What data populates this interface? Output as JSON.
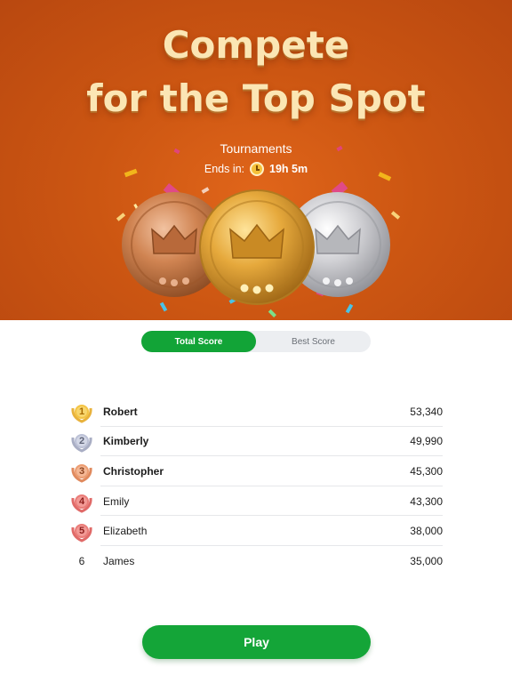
{
  "header": {
    "headline_line1": "Compete",
    "headline_line2": "for the Top Spot",
    "section_label": "Tournaments",
    "ends_label": "Ends in:",
    "ends_time": "19h 5m",
    "clock_icon": "clock-icon"
  },
  "medals": [
    {
      "name": "bronze-medal",
      "color": "#c97a4a"
    },
    {
      "name": "gold-medal",
      "color": "#e3a43a"
    },
    {
      "name": "silver-medal",
      "color": "#c6c6c8"
    }
  ],
  "tabs": [
    {
      "label": "Total Score",
      "active": true
    },
    {
      "label": "Best Score",
      "active": false
    }
  ],
  "leaderboard": [
    {
      "rank": "1",
      "name": "Robert",
      "score": "53,340",
      "badge": "gold",
      "bold": true
    },
    {
      "rank": "2",
      "name": "Kimberly",
      "score": "49,990",
      "badge": "silver",
      "bold": true
    },
    {
      "rank": "3",
      "name": "Christopher",
      "score": "45,300",
      "badge": "bronze",
      "bold": true
    },
    {
      "rank": "4",
      "name": "Emily",
      "score": "43,300",
      "badge": "red",
      "bold": false
    },
    {
      "rank": "5",
      "name": "Elizabeth",
      "score": "38,000",
      "badge": "red",
      "bold": false
    },
    {
      "rank": "6",
      "name": "James",
      "score": "35,000",
      "badge": "none",
      "bold": false
    }
  ],
  "play_button": {
    "label": "Play"
  },
  "colors": {
    "accent_green": "#14a538",
    "hero_orange": "#cc5612",
    "headline_cream": "#fbe6b4"
  }
}
